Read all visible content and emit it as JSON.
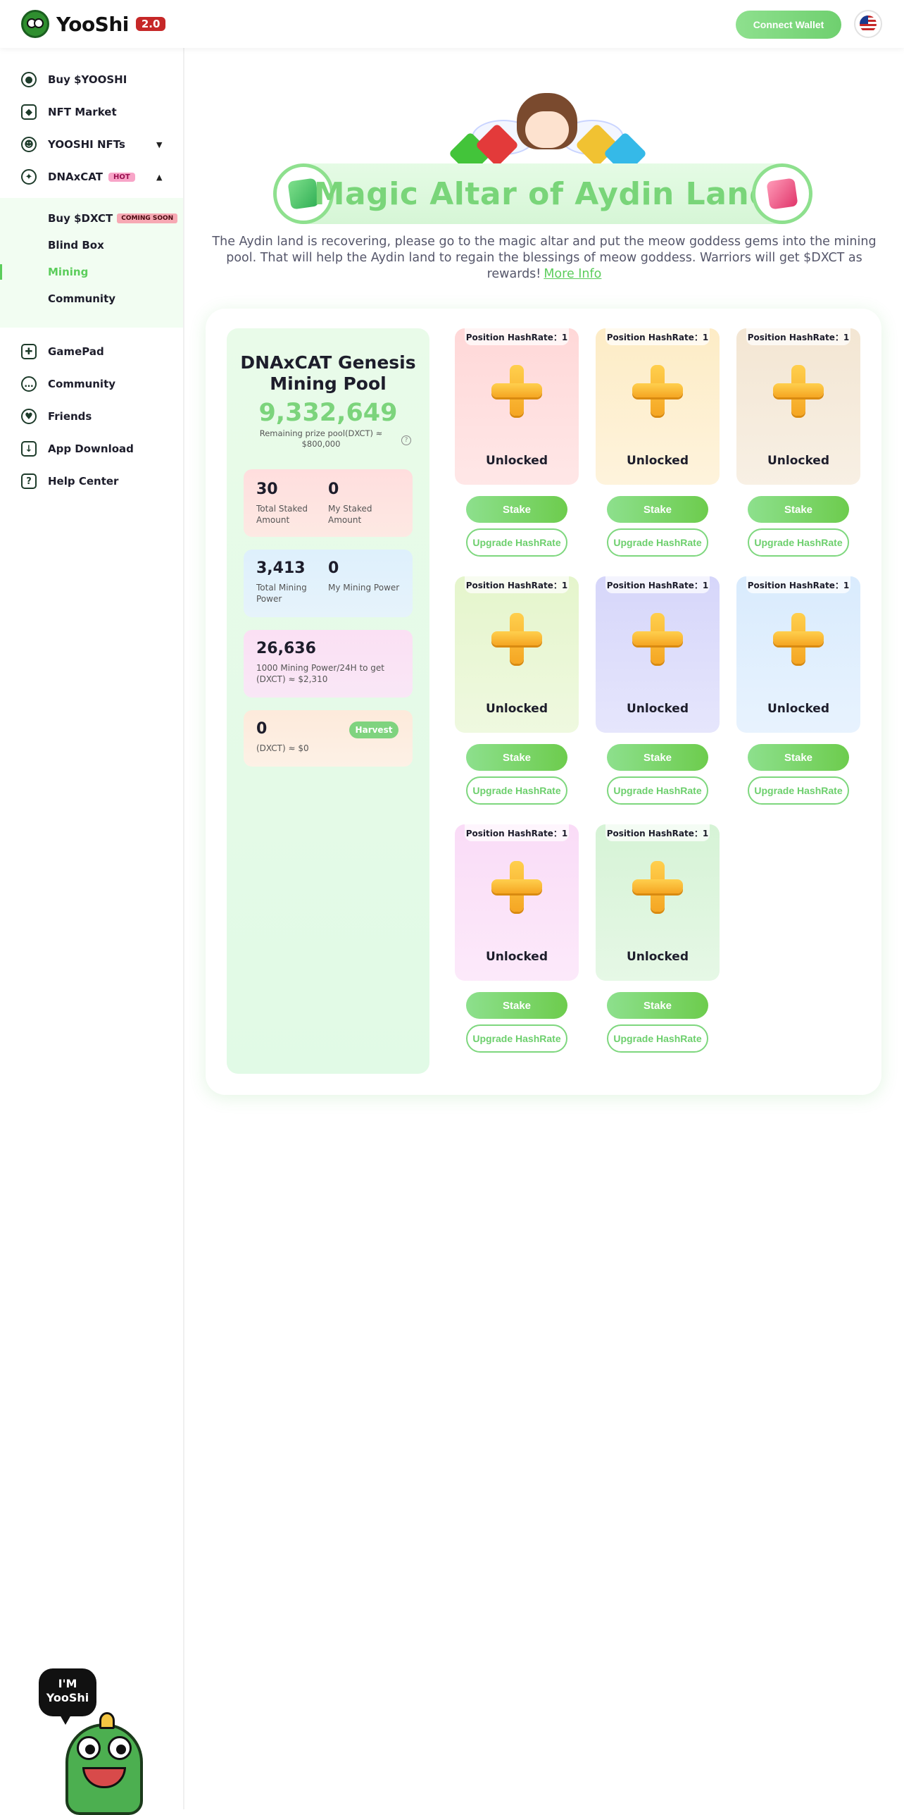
{
  "header": {
    "logo_text": "YooShi",
    "version_badge": "2.0",
    "connect_wallet": "Connect Wallet",
    "language_icon": "us-flag-icon"
  },
  "sidebar": {
    "items": [
      {
        "label": "Buy $YOOSHI",
        "icon": "token-icon"
      },
      {
        "label": "NFT Market",
        "icon": "diamond-icon"
      },
      {
        "label": "YOOSHI NFTs",
        "icon": "frog-icon"
      },
      {
        "label": "DNAxCAT",
        "icon": "cat-icon",
        "badge": "HOT"
      }
    ],
    "sub_items": [
      {
        "label": "Buy $DXCT",
        "badge": "COMING SOON"
      },
      {
        "label": "Blind Box"
      },
      {
        "label": "Mining"
      },
      {
        "label": "Community"
      }
    ],
    "bottom_items": [
      {
        "label": "GamePad",
        "icon": "gamepad-icon"
      },
      {
        "label": "Community",
        "icon": "chat-icon"
      },
      {
        "label": "Friends",
        "icon": "friends-icon"
      },
      {
        "label": "App Download",
        "icon": "download-icon"
      },
      {
        "label": "Help Center",
        "icon": "help-icon"
      }
    ],
    "mascot_bubble_line1": "I'M",
    "mascot_bubble_line2": "YooShi"
  },
  "hero": {
    "title": "Magic Altar of Aydin Land",
    "description": "The Aydin land is recovering, please go to the magic altar and put the meow goddess gems into the mining pool. That will help the Aydin land to regain the blessings of meow goddess. Warriors will get $DXCT as rewards!",
    "more_info": "More Info"
  },
  "pool": {
    "title": "DNAxCAT Genesis Mining Pool",
    "amount": "9,332,649",
    "remaining": "Remaining prize pool(DXCT) ≈ $800,000",
    "total_staked_value": "30",
    "total_staked_label": "Total Staked Amount",
    "my_staked_value": "0",
    "my_staked_label": "My Staked Amount",
    "total_power_value": "3,413",
    "total_power_label": "Total Mining Power",
    "my_power_value": "0",
    "my_power_label": "My Mining Power",
    "reward_value": "26,636",
    "reward_label": "1000 Mining Power/24H to get (DXCT) ≈ $2,310",
    "harvest_value": "0",
    "harvest_label": "(DXCT) ≈ $0",
    "harvest_button": "Harvest"
  },
  "slots": [
    {
      "position": "Position HashRate：1",
      "status": "Unlocked",
      "stake": "Stake",
      "upgrade": "Upgrade HashRate",
      "color": "#ffd8d8"
    },
    {
      "position": "Position HashRate：1",
      "status": "Unlocked",
      "stake": "Stake",
      "upgrade": "Upgrade HashRate",
      "color": "#fdecc6"
    },
    {
      "position": "Position HashRate：1",
      "status": "Unlocked",
      "stake": "Stake",
      "upgrade": "Upgrade HashRate",
      "color": "#f3e6d3"
    },
    {
      "position": "Position HashRate：1",
      "status": "Unlocked",
      "stake": "Stake",
      "upgrade": "Upgrade HashRate",
      "color": "#e5f5cc"
    },
    {
      "position": "Position HashRate：1",
      "status": "Unlocked",
      "stake": "Stake",
      "upgrade": "Upgrade HashRate",
      "color": "#d6d6fa"
    },
    {
      "position": "Position HashRate：1",
      "status": "Unlocked",
      "stake": "Stake",
      "upgrade": "Upgrade HashRate",
      "color": "#d9ebfd"
    },
    {
      "position": "Position HashRate：1",
      "status": "Unlocked",
      "stake": "Stake",
      "upgrade": "Upgrade HashRate",
      "color": "#fadcf7"
    },
    {
      "position": "Position HashRate：1",
      "status": "Unlocked",
      "stake": "Stake",
      "upgrade": "Upgrade HashRate",
      "color": "#d6f3d6"
    }
  ]
}
